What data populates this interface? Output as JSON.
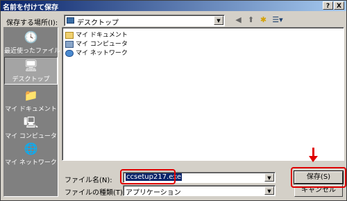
{
  "window": {
    "title": "名前を付けて保存",
    "help_btn": "?",
    "close_btn": "X"
  },
  "location": {
    "label": "保存する場所(I):",
    "value": "デスクトップ"
  },
  "toolbar": {
    "back": "◀",
    "up": "⬆",
    "new_folder": "✱",
    "views": "☰▾"
  },
  "places": [
    {
      "label": "最近使ったファイル",
      "icon": "clock-icon",
      "selected": false
    },
    {
      "label": "デスクトップ",
      "icon": "desktop-icon",
      "selected": true
    },
    {
      "label": "マイ ドキュメント",
      "icon": "documents-icon",
      "selected": false
    },
    {
      "label": "マイ コンピュータ",
      "icon": "computer-icon",
      "selected": false
    },
    {
      "label": "マイ ネットワーク",
      "icon": "network-icon",
      "selected": false
    }
  ],
  "files": [
    {
      "name": "マイ ドキュメント",
      "icon": "folder-icon"
    },
    {
      "name": "マイ コンピュータ",
      "icon": "computer-icon"
    },
    {
      "name": "マイ ネットワーク",
      "icon": "network-icon"
    }
  ],
  "filename": {
    "label": "ファイル名(N):",
    "value": "ccsetup217.exe"
  },
  "filetype": {
    "label": "ファイルの種類(T):",
    "value": "アプリケーション"
  },
  "buttons": {
    "save": "保存(S)",
    "cancel": "キャンセル"
  },
  "colors": {
    "title_start": "#0a246a",
    "title_end": "#a6caf0",
    "highlight": "#e00000"
  }
}
